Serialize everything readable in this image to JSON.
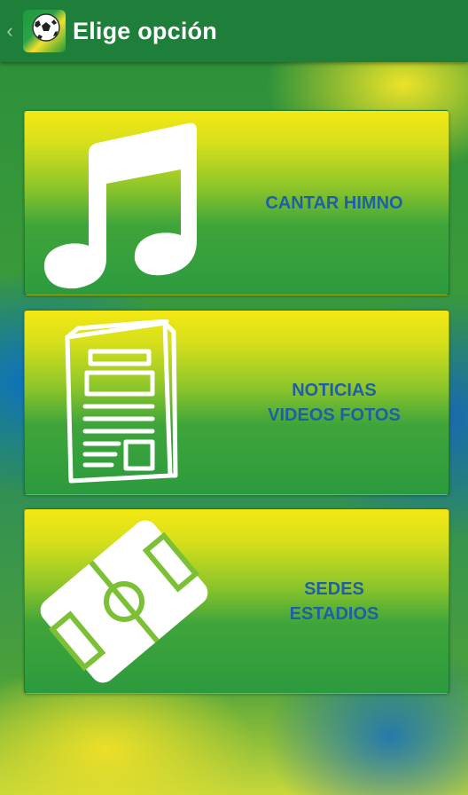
{
  "actionbar": {
    "title": "Elige opción",
    "back_icon": "chevron-left-icon",
    "app_icon": "soccer-ball-icon"
  },
  "options": [
    {
      "id": "himno",
      "icon": "music-note-icon",
      "lines": [
        "CANTAR HIMNO"
      ]
    },
    {
      "id": "noticias",
      "icon": "newspaper-icon",
      "lines": [
        "NOTICIAS",
        "VIDEOS FOTOS"
      ]
    },
    {
      "id": "sedes",
      "icon": "soccer-field-icon",
      "lines": [
        "SEDES",
        "ESTADIOS"
      ]
    }
  ],
  "colors": {
    "actionbar": "#1e7f3a",
    "label_text": "#1e5fa8",
    "card_top": "#f4e814",
    "card_bottom": "#2c9a3e"
  }
}
